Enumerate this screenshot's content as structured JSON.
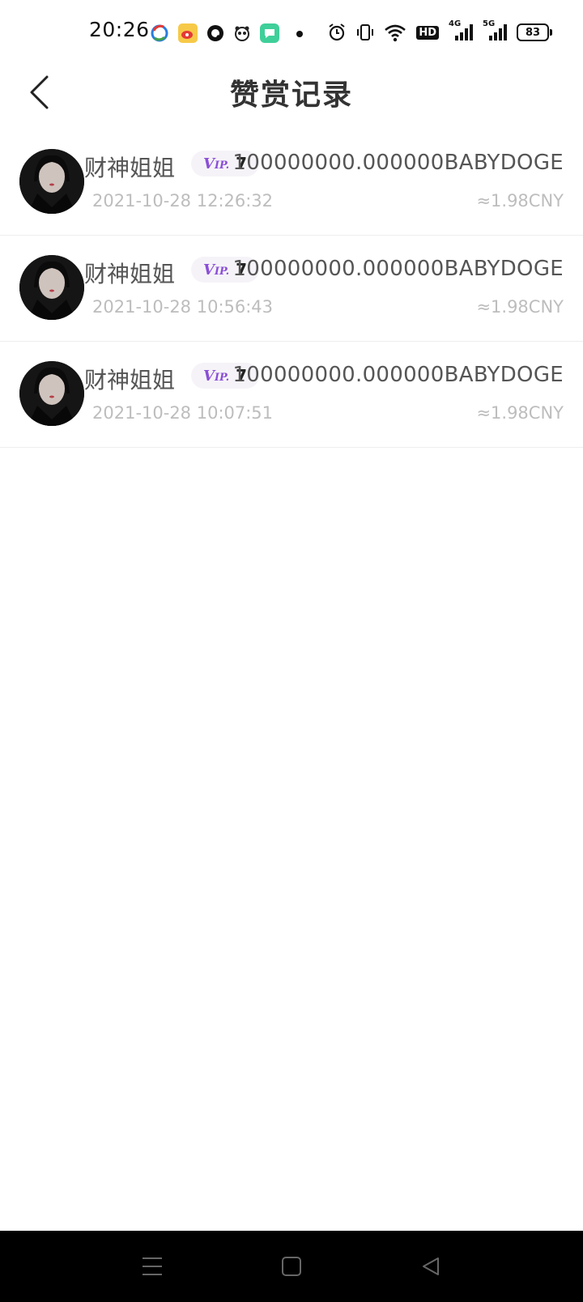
{
  "status_bar": {
    "time": "20:26",
    "battery": "83",
    "hd_label": "HD",
    "net1": "4G",
    "net2": "5G"
  },
  "header": {
    "title": "赞赏记录"
  },
  "records": [
    {
      "name": "财神姐姐",
      "vip_logo": "V",
      "vip_logo_suffix": "IP.",
      "vip_level": "7",
      "amount": "100000000.000000BABYDOGE",
      "time": "2021-10-28 12:26:32",
      "cny": "≈1.98CNY"
    },
    {
      "name": "财神姐姐",
      "vip_logo": "V",
      "vip_logo_suffix": "IP.",
      "vip_level": "7",
      "amount": "100000000.000000BABYDOGE",
      "time": "2021-10-28 10:56:43",
      "cny": "≈1.98CNY"
    },
    {
      "name": "财神姐姐",
      "vip_logo": "V",
      "vip_logo_suffix": "IP.",
      "vip_level": "7",
      "amount": "100000000.000000BABYDOGE",
      "time": "2021-10-28 10:07:51",
      "cny": "≈1.98CNY"
    }
  ],
  "colors": {
    "vip_accent": "#8a4fd6",
    "secondary_text": "#bdbdbd",
    "nav_background": "#000000"
  },
  "icons": {
    "back": "chevron-left-icon",
    "menu": "menu-icon",
    "home": "home-icon",
    "back_nav": "triangle-back-icon"
  }
}
